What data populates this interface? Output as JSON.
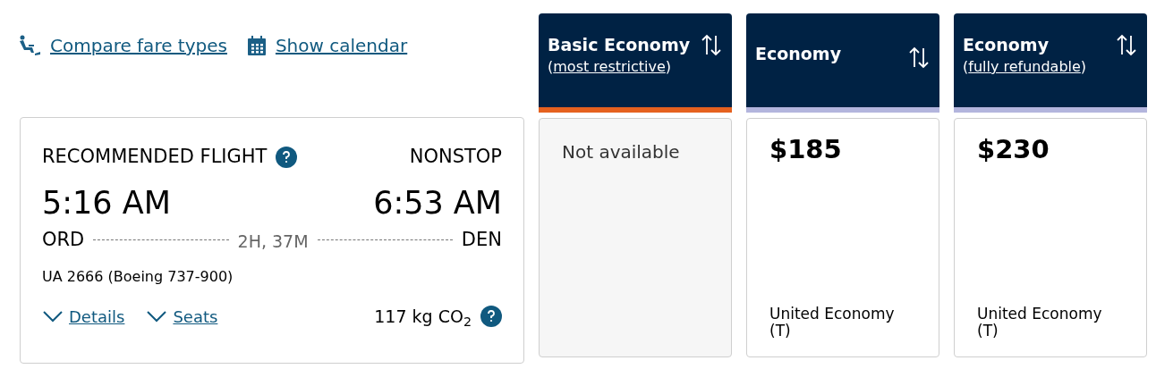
{
  "links": [
    {
      "kind": "seat",
      "label": "Compare fare types"
    },
    {
      "kind": "calendar",
      "label": "Show calendar"
    }
  ],
  "flight": {
    "title": "RECOMMENDED FLIGHT",
    "stops": "NONSTOP",
    "depart_time": "5:16 AM",
    "arrive_time": "6:53 AM",
    "origin": "ORD",
    "destination": "DEN",
    "duration": "2H, 37M",
    "flight_number": "UA 2666 (Boeing 737-900)",
    "toggles": [
      {
        "label": "Details",
        "expanded": false
      },
      {
        "label": "Seats",
        "expanded": false
      }
    ],
    "emissions": "117 kg CO$_{2}$"
  },
  "fare_columns": [
    {
      "title": "Basic Economy",
      "subtitle_open": "(",
      "subtitle_link": "most restrictive",
      "subtitle_close": ")",
      "color": "#e5611f",
      "cell": {
        "kind": "unavailable",
        "text": "Not available"
      }
    },
    {
      "title": "Economy",
      "color": "#b3b5dd",
      "cell": {
        "kind": "price",
        "price": "$185",
        "cabin": "United Economy",
        "fare_class": "(T)"
      }
    },
    {
      "title": "Economy",
      "subtitle_open": "(",
      "subtitle_link": "fully refundable",
      "subtitle_close": ")",
      "color": "#b3b5dd",
      "cell": {
        "kind": "price",
        "price": "$230",
        "cabin": "United Economy",
        "fare_class": "(T)"
      }
    }
  ]
}
